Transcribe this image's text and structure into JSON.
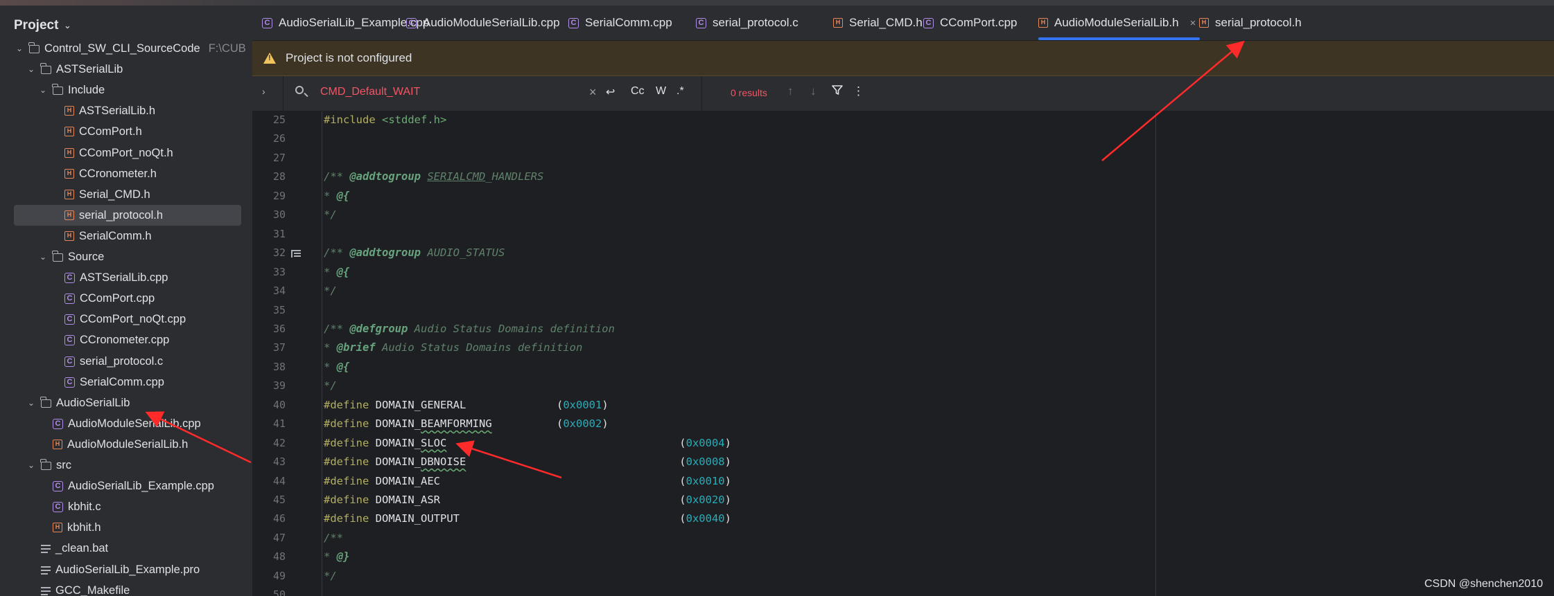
{
  "sidebar": {
    "title": "Project",
    "tree": [
      {
        "label": "Control_SW_CLI_SourceCode",
        "hint": "F:\\CUB",
        "type": "folder",
        "depth": 0,
        "expanded": true
      },
      {
        "label": "ASTSerialLib",
        "type": "folder",
        "depth": 1,
        "expanded": true
      },
      {
        "label": "Include",
        "type": "folder",
        "depth": 2,
        "expanded": true
      },
      {
        "label": "ASTSerialLib.h",
        "type": "h",
        "depth": 3
      },
      {
        "label": "CComPort.h",
        "type": "h",
        "depth": 3
      },
      {
        "label": "CComPort_noQt.h",
        "type": "h",
        "depth": 3
      },
      {
        "label": "CCronometer.h",
        "type": "h",
        "depth": 3
      },
      {
        "label": "Serial_CMD.h",
        "type": "h",
        "depth": 3
      },
      {
        "label": "serial_protocol.h",
        "type": "h",
        "depth": 3,
        "selected": true
      },
      {
        "label": "SerialComm.h",
        "type": "h",
        "depth": 3
      },
      {
        "label": "Source",
        "type": "folder",
        "depth": 2,
        "expanded": true
      },
      {
        "label": "ASTSerialLib.cpp",
        "type": "cpp",
        "depth": 3
      },
      {
        "label": "CComPort.cpp",
        "type": "cpp",
        "depth": 3
      },
      {
        "label": "CComPort_noQt.cpp",
        "type": "cpp",
        "depth": 3
      },
      {
        "label": "CCronometer.cpp",
        "type": "cpp",
        "depth": 3
      },
      {
        "label": "serial_protocol.c",
        "type": "c",
        "depth": 3
      },
      {
        "label": "SerialComm.cpp",
        "type": "cpp",
        "depth": 3
      },
      {
        "label": "AudioSerialLib",
        "type": "folder",
        "depth": 1,
        "expanded": true
      },
      {
        "label": "AudioModuleSerialLib.cpp",
        "type": "cpp",
        "depth": 2
      },
      {
        "label": "AudioModuleSerialLib.h",
        "type": "h",
        "depth": 2
      },
      {
        "label": "src",
        "type": "folder",
        "depth": 1,
        "expanded": true
      },
      {
        "label": "AudioSerialLib_Example.cpp",
        "type": "cpp",
        "depth": 2
      },
      {
        "label": "kbhit.c",
        "type": "c",
        "depth": 2
      },
      {
        "label": "kbhit.h",
        "type": "h",
        "depth": 2
      },
      {
        "label": "_clean.bat",
        "type": "txt",
        "depth": 1
      },
      {
        "label": "AudioSerialLib_Example.pro",
        "type": "txt",
        "depth": 1
      },
      {
        "label": "GCC_Makefile",
        "type": "txt",
        "depth": 1
      }
    ]
  },
  "tabs": [
    {
      "label": "AudioSerialLib_Example.cpp",
      "type": "cpp"
    },
    {
      "label": "AudioModuleSerialLib.cpp",
      "type": "cpp"
    },
    {
      "label": "SerialComm.cpp",
      "type": "cpp"
    },
    {
      "label": "serial_protocol.c",
      "type": "c"
    },
    {
      "label": "Serial_CMD.h",
      "type": "h"
    },
    {
      "label": "CComPort.cpp",
      "type": "cpp"
    },
    {
      "label": "AudioModuleSerialLib.h",
      "type": "h",
      "active": true
    },
    {
      "label": "serial_protocol.h",
      "type": "h"
    }
  ],
  "banner": {
    "text": "Project is not configured",
    "icon": "warning-icon"
  },
  "search": {
    "query": "CMD_Default_WAIT",
    "opt_case": "Cc",
    "opt_words": "W",
    "opt_regex": ".*",
    "results": "0 results"
  },
  "editor": {
    "lines": [
      {
        "n": "25"
      },
      {
        "n": "26"
      },
      {
        "n": "27"
      },
      {
        "n": "28"
      },
      {
        "n": "29"
      },
      {
        "n": "30"
      },
      {
        "n": "31"
      },
      {
        "n": "32",
        "mark": true
      },
      {
        "n": "33"
      },
      {
        "n": "34"
      },
      {
        "n": "35"
      },
      {
        "n": "36"
      },
      {
        "n": "37"
      },
      {
        "n": "38"
      },
      {
        "n": "39"
      },
      {
        "n": "40"
      },
      {
        "n": "41"
      },
      {
        "n": "42"
      },
      {
        "n": "43"
      },
      {
        "n": "44"
      },
      {
        "n": "45"
      },
      {
        "n": "46"
      },
      {
        "n": "47"
      },
      {
        "n": "48"
      },
      {
        "n": "49"
      },
      {
        "n": "50"
      }
    ],
    "code": {
      "l25_kw": "#include",
      "l25_str": "<stddef.h>",
      "l28_a": "/** ",
      "l28_tag": "@addtogroup",
      "l28_ref": "SERIALCMD",
      "l28_b": "_HANDLERS",
      "l29_a": "* ",
      "l29_tag": "@{",
      "l30": "*/",
      "l32_a": "/** ",
      "l32_tag": "@addtogroup",
      "l32_b": " AUDIO_STATUS",
      "l33_a": "* ",
      "l33_tag": "@{",
      "l34": "*/",
      "l36_a": "/** ",
      "l36_tag": "@defgroup",
      "l36_b": " Audio Status Domains definition",
      "l37_a": "* ",
      "l37_tag": "@brief",
      "l37_b": " Audio Status Domains definition",
      "l38_a": "* ",
      "l38_tag": "@{",
      "l39": "*/",
      "define": "#define",
      "l40_name": "DOMAIN_GENERAL",
      "l40_val": "0x0001",
      "l41_name_a": "DOMAIN_",
      "l41_name_b": "BEAMFORMING",
      "l41_val": "0x0002",
      "l42_name_a": "DOMAIN_",
      "l42_name_b": "SLOC",
      "l42_val": "0x0004",
      "l43_name_a": "DOMAIN_",
      "l43_name_b": "DBNOISE",
      "l43_val": "0x0008",
      "l44_name": "DOMAIN_AEC",
      "l44_val": "0x0010",
      "l45_name": "DOMAIN_ASR",
      "l45_val": "0x0020",
      "l46_name": "DOMAIN_OUTPUT",
      "l46_val": "0x0040",
      "l47": "/**",
      "l48_a": "* ",
      "l48_tag": "@}",
      "l49": "*/",
      "paren_open": "(",
      "paren_close": ")"
    }
  },
  "watermark": "CSDN @shenchen2010",
  "colors": {
    "annotation_arrow": "#ff2a2a",
    "active_tab": "#3574f0"
  }
}
